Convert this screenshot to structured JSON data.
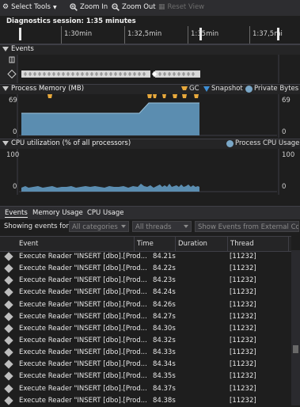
{
  "toolbar": {
    "select_tools": "Select Tools",
    "zoom_in": "Zoom In",
    "zoom_out": "Zoom Out",
    "reset_view": "Reset View"
  },
  "session": {
    "label": "Diagnostics session: 1:35 minutes"
  },
  "ruler": {
    "ticks": [
      "1:30min",
      "1:32,5min",
      "1:35min",
      "1:37,5mi"
    ]
  },
  "events_section": {
    "title": "Events"
  },
  "memory_section": {
    "title": "Process Memory (MB)",
    "legend_gc": "GC",
    "legend_snapshot": "Snapshot",
    "legend_private": "Private Bytes",
    "y_max": "69",
    "y_min": "0",
    "colors": {
      "private_bytes": "#5b8db0",
      "gc": "#e8a93c",
      "snapshot": "#3e8fd6"
    }
  },
  "cpu_section": {
    "title": "CPU utilization (% of all processors)",
    "legend": "Process CPU Usage",
    "y_max": "100",
    "y_min": "0",
    "color": "#5b8db0"
  },
  "tabs": [
    "Events",
    "Memory Usage",
    "CPU Usage"
  ],
  "filter": {
    "label": "Showing events for:",
    "categories": "All categories",
    "threads": "All threads",
    "external_code": "Show Events from External Code"
  },
  "table": {
    "columns": [
      "Event",
      "Time",
      "Duration",
      "Thread"
    ],
    "rows": [
      {
        "event": "Execute Reader \"INSERT [dbo].[Prod...",
        "time": "84.21s",
        "duration": "",
        "thread": "[11232]"
      },
      {
        "event": "Execute Reader \"INSERT [dbo].[Prod...",
        "time": "84.22s",
        "duration": "",
        "thread": "[11232]"
      },
      {
        "event": "Execute Reader \"INSERT [dbo].[Prod...",
        "time": "84.23s",
        "duration": "",
        "thread": "[11232]"
      },
      {
        "event": "Execute Reader \"INSERT [dbo].[Prod...",
        "time": "84.24s",
        "duration": "",
        "thread": "[11232]"
      },
      {
        "event": "Execute Reader \"INSERT [dbo].[Prod...",
        "time": "84.26s",
        "duration": "",
        "thread": "[11232]"
      },
      {
        "event": "Execute Reader \"INSERT [dbo].[Prod...",
        "time": "84.27s",
        "duration": "",
        "thread": "[11232]"
      },
      {
        "event": "Execute Reader \"INSERT [dbo].[Prod...",
        "time": "84.30s",
        "duration": "",
        "thread": "[11232]"
      },
      {
        "event": "Execute Reader \"INSERT [dbo].[Prod...",
        "time": "84.32s",
        "duration": "",
        "thread": "[11232]"
      },
      {
        "event": "Execute Reader \"INSERT [dbo].[Prod...",
        "time": "84.33s",
        "duration": "",
        "thread": "[11232]"
      },
      {
        "event": "Execute Reader \"INSERT [dbo].[Prod...",
        "time": "84.34s",
        "duration": "",
        "thread": "[11232]"
      },
      {
        "event": "Execute Reader \"INSERT [dbo].[Prod...",
        "time": "84.35s",
        "duration": "",
        "thread": "[11232]"
      },
      {
        "event": "Execute Reader \"INSERT [dbo].[Prod...",
        "time": "84.37s",
        "duration": "",
        "thread": "[11232]"
      },
      {
        "event": "Execute Reader \"INSERT [dbo].[Prod...",
        "time": "84.38s",
        "duration": "",
        "thread": "[11232]"
      }
    ]
  }
}
